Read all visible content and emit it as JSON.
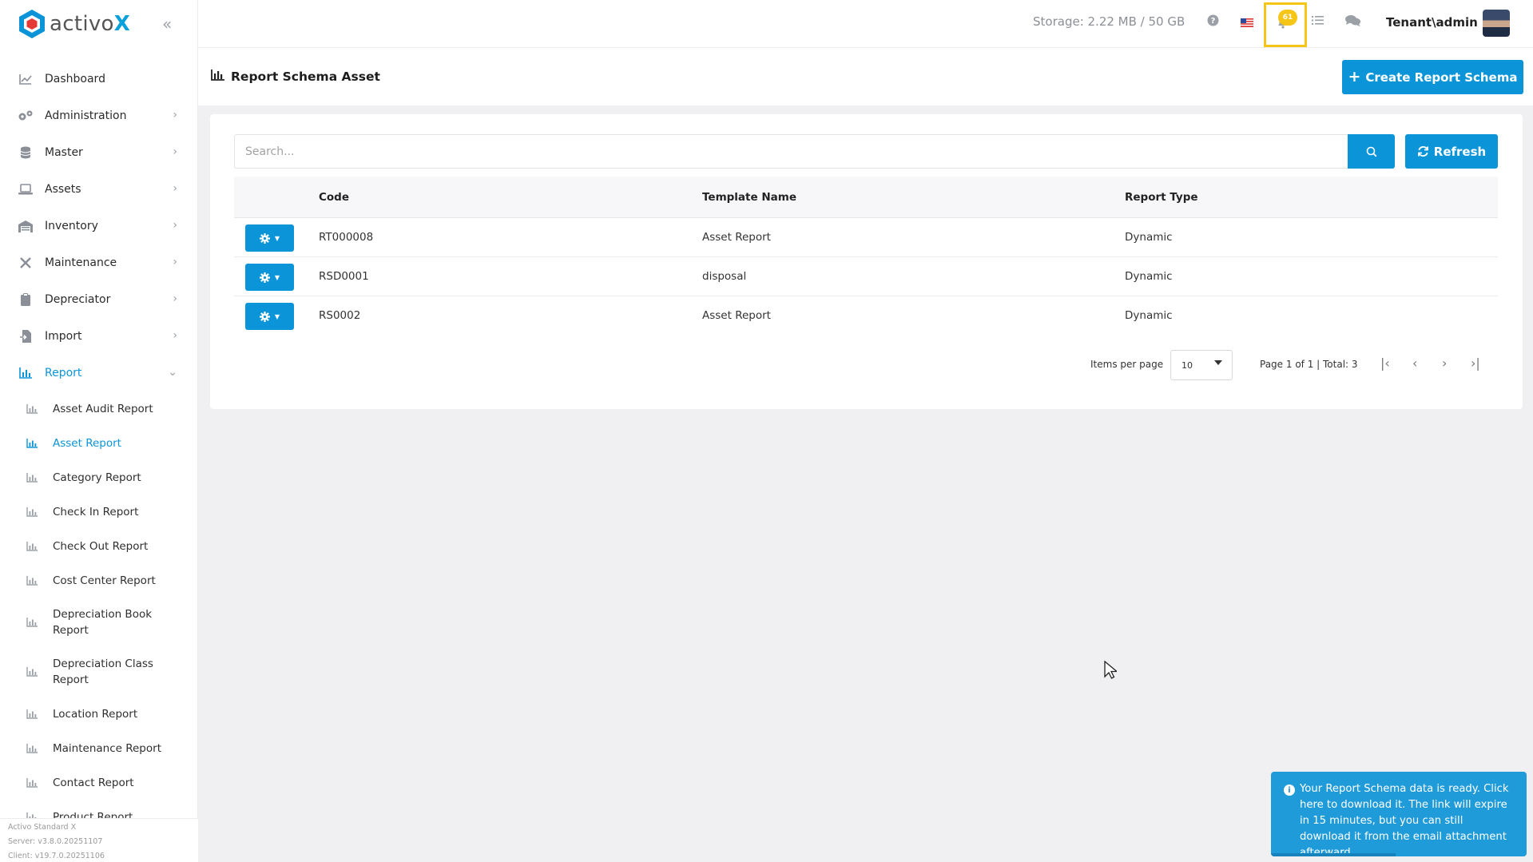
{
  "brand": {
    "name_main": "activo",
    "name_x": "X"
  },
  "sidebar": {
    "items": [
      {
        "label": "Dashboard",
        "icon": "chart-line-icon",
        "has_chevron": false
      },
      {
        "label": "Administration",
        "icon": "cogs-icon",
        "has_chevron": true
      },
      {
        "label": "Master",
        "icon": "database-icon",
        "has_chevron": true
      },
      {
        "label": "Assets",
        "icon": "laptop-icon",
        "has_chevron": true
      },
      {
        "label": "Inventory",
        "icon": "warehouse-icon",
        "has_chevron": true
      },
      {
        "label": "Maintenance",
        "icon": "tools-icon",
        "has_chevron": true
      },
      {
        "label": "Depreciator",
        "icon": "clipboard-icon",
        "has_chevron": true
      },
      {
        "label": "Import",
        "icon": "file-import-icon",
        "has_chevron": true
      },
      {
        "label": "Report",
        "icon": "bar-chart-icon",
        "has_chevron": true,
        "active": true
      }
    ],
    "report_subitems": [
      {
        "label": "Asset Audit Report"
      },
      {
        "label": "Asset Report",
        "active": true
      },
      {
        "label": "Category Report"
      },
      {
        "label": "Check In Report"
      },
      {
        "label": "Check Out Report"
      },
      {
        "label": "Cost Center Report"
      },
      {
        "label": "Depreciation Book Report"
      },
      {
        "label": "Depreciation Class Report"
      },
      {
        "label": "Location Report"
      },
      {
        "label": "Maintenance Report"
      },
      {
        "label": "Contact Report"
      },
      {
        "label": "Product Report"
      }
    ],
    "footer": {
      "product": "Activo Standard X",
      "server": "Server: v3.8.0.20251107",
      "client": "Client: v19.7.0.20251106"
    }
  },
  "topbar": {
    "storage": "Storage: 2.22 MB / 50 GB",
    "notification_count": "61",
    "tenant": "Tenant\\admin"
  },
  "page": {
    "title": "Report Schema Asset",
    "create_label": "Create Report Schema"
  },
  "search": {
    "placeholder": "Search...",
    "refresh_label": "Refresh"
  },
  "table": {
    "headers": {
      "code": "Code",
      "template_name": "Template Name",
      "report_type": "Report Type"
    },
    "rows": [
      {
        "code": "RT000008",
        "template_name": "Asset Report",
        "report_type": "Dynamic"
      },
      {
        "code": "RSD0001",
        "template_name": "disposal",
        "report_type": "Dynamic"
      },
      {
        "code": "RS0002",
        "template_name": "Asset Report",
        "report_type": "Dynamic"
      }
    ]
  },
  "pager": {
    "items_per_page_label": "Items per page",
    "items_per_page_value": "10",
    "page_info": "Page 1 of 1 | Total: 3"
  },
  "toast": {
    "message": "Your Report Schema data is ready. Click here to download it. The link will expire in 15 minutes, but you can still download it from the email attachment afterward."
  },
  "colors": {
    "accent": "#0b95d8",
    "highlight": "#f5c518",
    "toast": "#1f9bda"
  }
}
